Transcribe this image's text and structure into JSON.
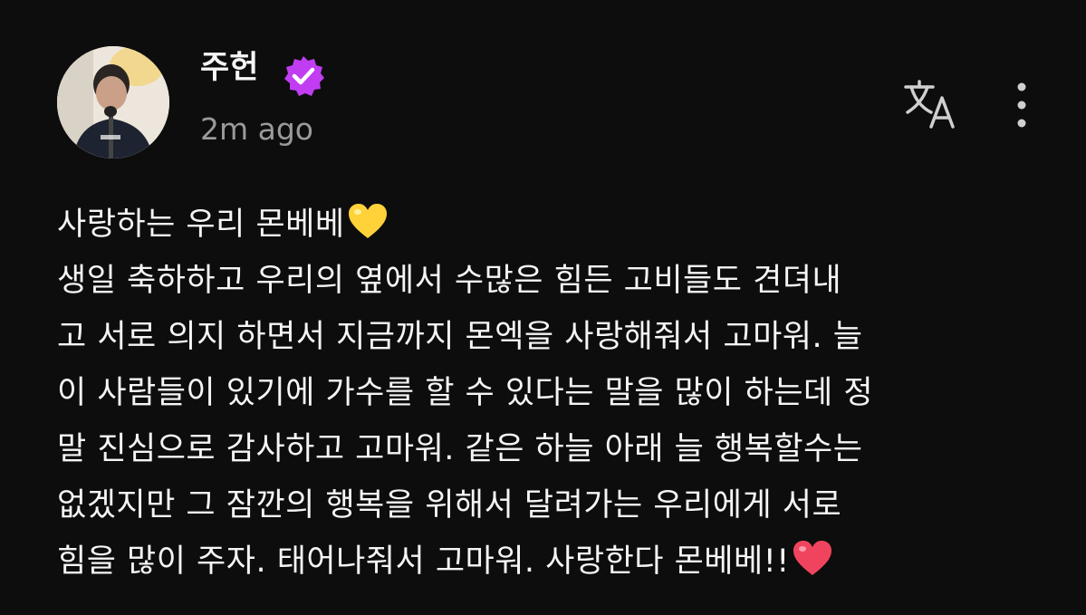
{
  "author": {
    "name": "주헌",
    "timestamp": "2m ago",
    "verified_badge_color": "#c13df2"
  },
  "icons": {
    "translate": "translate-icon",
    "more": "more-vertical-icon",
    "verified": "verified-badge-icon",
    "yellow_heart": "yellow-heart-emoji",
    "red_heart": "red-heart-emoji"
  },
  "post": {
    "lines": [
      "사랑하는 우리 몬베베",
      "생일 축하하고 우리의 옆에서 수많은 힘든 고비들도 견뎌내",
      "고 서로 의지 하면서 지금까지 몬엑을 사랑해줘서 고마워. 늘",
      "이 사람들이 있기에 가수를 할 수 있다는 말을 많이 하는데 정",
      "말 진심으로 감사하고 고마워. 같은 하늘 아래 늘 행복할수는",
      "없겠지만 그 잠깐의 행복을 위해서 달려가는 우리에게 서로",
      "힘을 많이 주자. 태어나줘서 고마워. 사랑한다 몬베베!!"
    ]
  },
  "colors": {
    "background": "#0d0d0d",
    "text": "#f5f5f5",
    "muted": "#9a9a9a",
    "yellow_heart": "#ffd23a",
    "red_heart": "#f0445e"
  }
}
